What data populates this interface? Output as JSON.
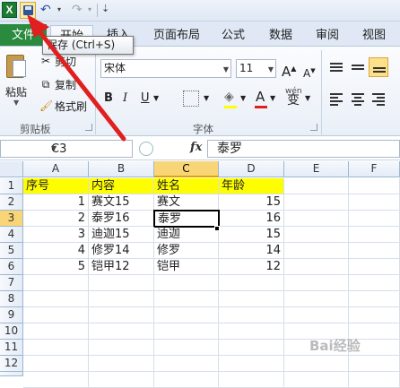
{
  "app": {
    "logo_letter": "X"
  },
  "qat": {
    "undo": "↶",
    "redo": "↷",
    "dropdown": "▾",
    "customize": "⇣"
  },
  "tabs": {
    "file": "文件",
    "home": "开始",
    "insert": "插入",
    "page_layout": "页面布局",
    "formulas": "公式",
    "data": "数据",
    "review": "审阅",
    "view": "视图"
  },
  "tooltip": {
    "text": "保存 (Ctrl+S)"
  },
  "ribbon": {
    "clipboard": {
      "paste": "粘贴",
      "cut": "剪切",
      "copy": "复制",
      "format_painter": "格式刷",
      "group_label": "剪贴板"
    },
    "font": {
      "name": "宋体",
      "size": "11",
      "group_label": "字体",
      "bold": "B",
      "italic": "I",
      "underline": "U",
      "grow": "A",
      "shrink": "A",
      "wen": "wén",
      "wen_char": "变"
    }
  },
  "formula_bar": {
    "name_box": "C3",
    "fx": "fx",
    "content": "泰罗"
  },
  "columns": [
    "A",
    "B",
    "C",
    "D",
    "E",
    "F"
  ],
  "rows": [
    "1",
    "2",
    "3",
    "4",
    "5",
    "6",
    "7",
    "8",
    "9",
    "10",
    "11",
    "12",
    "13"
  ],
  "table": {
    "headers": [
      "序号",
      "内容",
      "姓名",
      "年龄"
    ],
    "rows": [
      [
        "1",
        "赛文15",
        "赛文",
        "15"
      ],
      [
        "2",
        "泰罗16",
        "泰罗",
        "16"
      ],
      [
        "3",
        "迪迦15",
        "迪迦",
        "15"
      ],
      [
        "4",
        "修罗14",
        "修罗",
        "14"
      ],
      [
        "5",
        "铠甲12",
        "铠甲",
        "12"
      ]
    ]
  },
  "selected_cell": "C3",
  "colors": {
    "file_tab": "#2a8a3e",
    "header_fill": "#fefe00",
    "arrow": "#e02020"
  },
  "watermark": "Bai经验"
}
